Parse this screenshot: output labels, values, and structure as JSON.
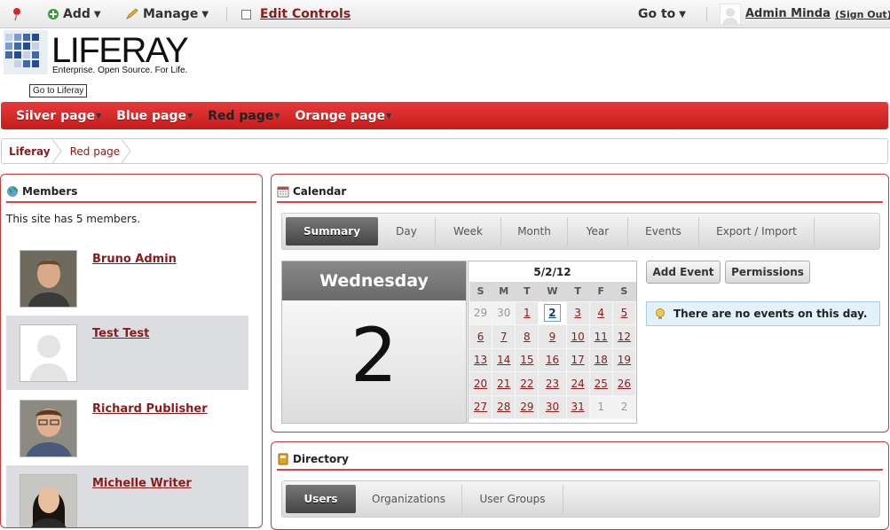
{
  "dock": {
    "add_label": "Add",
    "manage_label": "Manage",
    "edit_controls_label": "Edit Controls",
    "goto_label": "Go to",
    "user_name": "Admin Minda",
    "sign_out_label": "(Sign Out)"
  },
  "logo": {
    "brand": "LIFERAY",
    "tagline": "Enterprise. Open Source. For Life.",
    "tooltip": "Go to Liferay"
  },
  "nav": {
    "items": [
      {
        "label": "Silver page",
        "selected": false
      },
      {
        "label": "Blue page",
        "selected": false
      },
      {
        "label": "Red page",
        "selected": true
      },
      {
        "label": "Orange page",
        "selected": false
      }
    ]
  },
  "breadcrumb": [
    "Liferay",
    "Red page"
  ],
  "members": {
    "title": "Members",
    "intro": "This site has 5 members.",
    "list": [
      {
        "name": "Bruno Admin"
      },
      {
        "name": "Test Test"
      },
      {
        "name": "Richard Publisher"
      },
      {
        "name": "Michelle Writer"
      }
    ]
  },
  "calendar": {
    "title": "Calendar",
    "tabs": [
      "Summary",
      "Day",
      "Week",
      "Month",
      "Year",
      "Events",
      "Export / Import"
    ],
    "active_tab": "Summary",
    "day_name": "Wednesday",
    "day_number": "2",
    "mini_title": "5/2/12",
    "weekdays": [
      "S",
      "M",
      "T",
      "W",
      "T",
      "F",
      "S"
    ],
    "weeks": [
      [
        "29",
        "30",
        "1",
        "2",
        "3",
        "4",
        "5"
      ],
      [
        "6",
        "7",
        "8",
        "9",
        "10",
        "11",
        "12"
      ],
      [
        "13",
        "14",
        "15",
        "16",
        "17",
        "18",
        "19"
      ],
      [
        "20",
        "21",
        "22",
        "23",
        "24",
        "25",
        "26"
      ],
      [
        "27",
        "28",
        "29",
        "30",
        "31",
        "1",
        "2"
      ]
    ],
    "add_event_label": "Add Event",
    "permissions_label": "Permissions",
    "no_events": "There are no events on this day."
  },
  "directory": {
    "title": "Directory",
    "tabs": [
      "Users",
      "Organizations",
      "User Groups"
    ],
    "active_tab": "Users"
  },
  "colors": {
    "accent": "#d12a2a",
    "link": "#8b1a1a"
  }
}
